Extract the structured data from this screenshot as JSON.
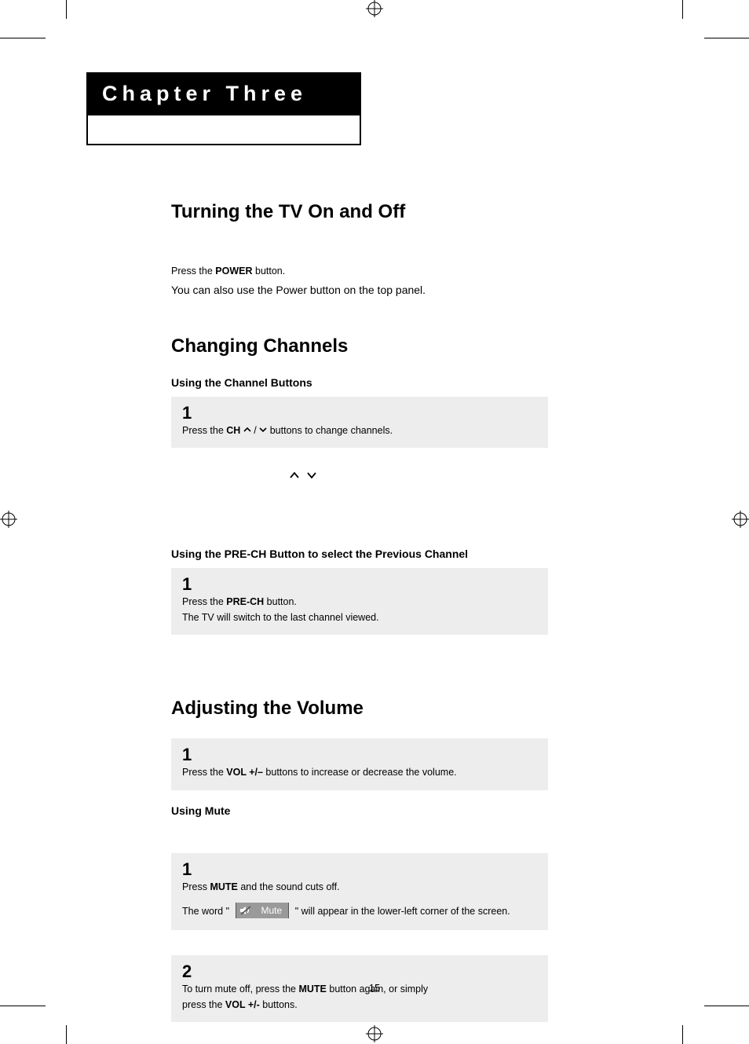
{
  "chapter": {
    "label": "Chapter Three"
  },
  "section_tv": {
    "heading": "Turning the TV On and Off",
    "line1_pre": "Press the ",
    "line1_bold": "POWER",
    "line1_post": " button.",
    "line2": "You can also use the Power button on the top panel."
  },
  "section_channels": {
    "heading": "Changing Channels",
    "sub1": "Using the Channel Buttons",
    "step1": {
      "num": "1",
      "pre": "Press the ",
      "bold": "CH",
      "mid": " ",
      "slash": " / ",
      "post": " buttons to change channels."
    },
    "sub2": "Using the PRE-CH Button to select the Previous Channel",
    "step2": {
      "num": "1",
      "l1_pre": "Press the ",
      "l1_bold": "PRE-CH",
      "l1_post": " button.",
      "l2": "The TV will switch to the last channel viewed."
    }
  },
  "section_volume": {
    "heading": "Adjusting the Volume",
    "step1": {
      "num": "1",
      "pre": "Press the ",
      "bold": "VOL +/–",
      "post": " buttons to increase or decrease the volume."
    },
    "sub_mute": "Using Mute",
    "mute1": {
      "num": "1",
      "l1_pre": "Press ",
      "l1_bold": "MUTE",
      "l1_post": " and the sound cuts off.",
      "l2_pre": "The word ",
      "l2_quote_open": "\"",
      "badge_label": "Mute",
      "l2_quote_close": "\"",
      "l2_post": " will appear in the lower-left corner of the screen."
    },
    "mute2": {
      "num": "2",
      "l1_pre": "To turn mute off, press the ",
      "l1_bold": "MUTE",
      "l1_post": " button again, or simply",
      "l2_pre": "press the ",
      "l2_bold": "VOL +/-",
      "l2_post": " buttons."
    }
  },
  "page_number": "15"
}
